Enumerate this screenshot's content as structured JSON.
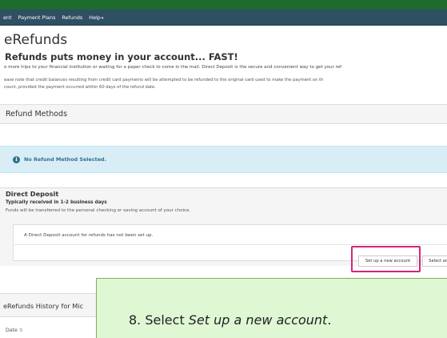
{
  "nav": {
    "items": [
      "ent",
      "Payment Plans",
      "Refunds",
      "Help"
    ],
    "help_caret": "▾"
  },
  "page": {
    "title": "eRefunds",
    "headline": "Refunds puts money in your account... FAST!",
    "intro": "o more trips to your financial institution or waiting for a paper check to come in the mail. Direct Deposit is the secure and convenient way to get your ref",
    "note_line1": "ease note that credit balances resulting from credit card payments will be attempted to be refunded to the original card used to make the payment on th",
    "note_line2": "count, provided the payment occurred within 60 days of the refund date."
  },
  "refund_methods": {
    "heading": "Refund Methods",
    "alert_icon": "i",
    "alert_text": "No Refund Method Selected."
  },
  "direct_deposit": {
    "title": "Direct Deposit",
    "subtitle": "Typically received in 1-2 business days",
    "description": "Funds will be transferred to the personal checking or saving account of your choice.",
    "message": "A Direct Deposit account for refunds has not been set up.",
    "setup_button": "Set up a new account",
    "select_button": "Select ac"
  },
  "history": {
    "heading": "eRefunds History for Mic",
    "date_column": "Date",
    "sort_glyph": "⇅"
  },
  "callout": {
    "prefix": "8. Select ",
    "emphasis": "Set up a new account",
    "suffix": "."
  },
  "colors": {
    "top_bar": "#1e6b2e",
    "nav_bar": "#2f4f63",
    "highlight": "#d6247a",
    "callout_bg": "#dff7d3",
    "alert_bg": "#d9edf7"
  }
}
